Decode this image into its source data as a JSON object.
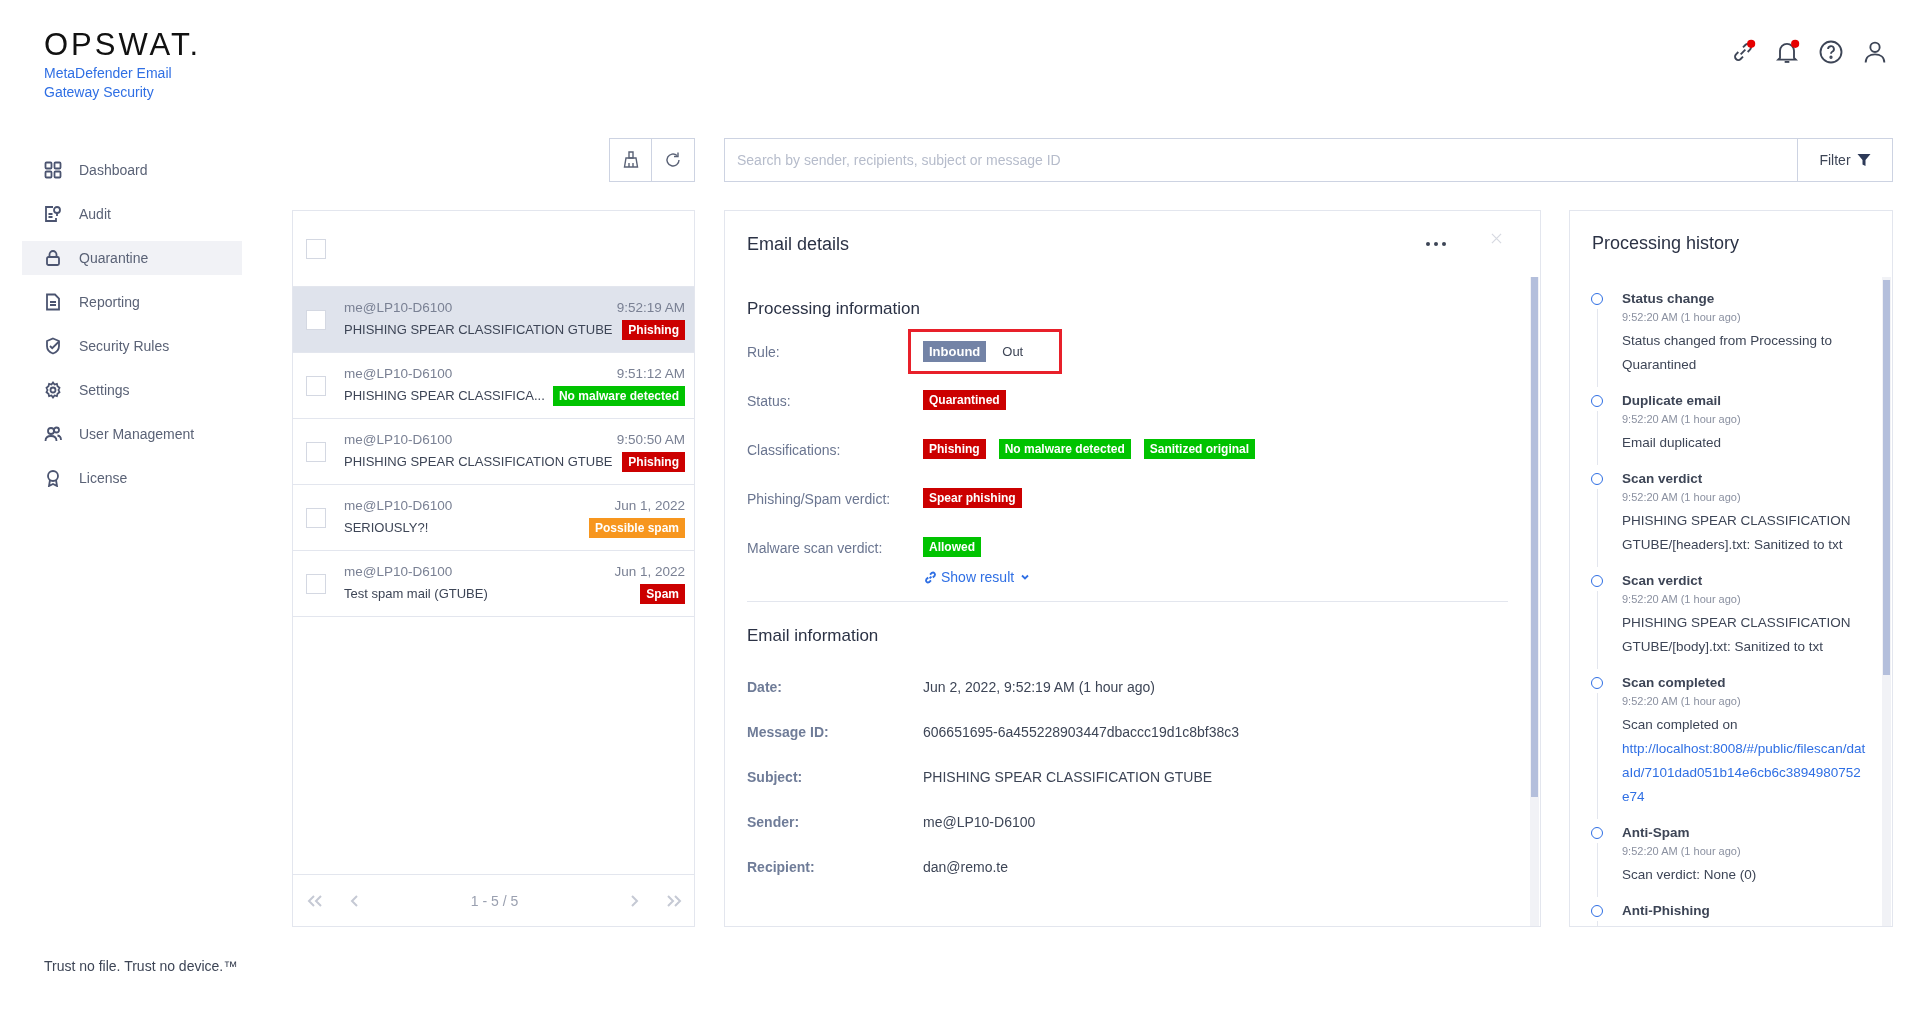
{
  "brand": {
    "logo": "OPSWAT.",
    "product": "MetaDefender Email Gateway Security"
  },
  "sidebar": {
    "items": [
      {
        "label": "Dashboard",
        "selected": false
      },
      {
        "label": "Audit",
        "selected": false
      },
      {
        "label": "Quarantine",
        "selected": true
      },
      {
        "label": "Reporting",
        "selected": false
      },
      {
        "label": "Security Rules",
        "selected": false
      },
      {
        "label": "Settings",
        "selected": false
      },
      {
        "label": "User Management",
        "selected": false
      },
      {
        "label": "License",
        "selected": false
      }
    ],
    "footer": "Trust no file. Trust no device.™"
  },
  "top_icons": [
    {
      "kind": "link",
      "alert": true
    },
    {
      "kind": "bell",
      "alert": true
    },
    {
      "kind": "help",
      "alert": false
    },
    {
      "kind": "user",
      "alert": false
    }
  ],
  "search": {
    "placeholder": "Search by sender, recipients, subject or message ID",
    "filter": "Filter"
  },
  "email_list": {
    "all_checked": false,
    "rows": [
      {
        "sender": "me@LP10-D6100",
        "time": "9:52:19 AM",
        "subject": "PHISHING SPEAR CLASSIFICATION GTUBE",
        "tag": "Phishing",
        "color": "#cc0000",
        "selected": true,
        "checked": false
      },
      {
        "sender": "me@LP10-D6100",
        "time": "9:51:12 AM",
        "subject": "PHISHING SPEAR CLASSIFICA...",
        "tag": "No malware detected",
        "color": "#00c300",
        "selected": false,
        "checked": false
      },
      {
        "sender": "me@LP10-D6100",
        "time": "9:50:50 AM",
        "subject": "PHISHING SPEAR CLASSIFICATION GTUBE",
        "tag": "Phishing",
        "color": "#cc0000",
        "selected": false,
        "checked": false
      },
      {
        "sender": "me@LP10-D6100",
        "time": "Jun 1, 2022",
        "subject": "SERIOUSLY?!",
        "tag": "Possible spam",
        "color": "#f7961e",
        "selected": false,
        "checked": false
      },
      {
        "sender": "me@LP10-D6100",
        "time": "Jun 1, 2022",
        "subject": "Test spam mail (GTUBE)",
        "tag": "Spam",
        "color": "#cc0000",
        "selected": false,
        "checked": false
      }
    ],
    "pagination": "1 - 5 / 5"
  },
  "email_details": {
    "title": "Email details",
    "processing": {
      "heading": "Processing information",
      "rule": {
        "label": "Rule:",
        "highlighted": true,
        "options": [
          {
            "label": "Inbound",
            "selected": true
          },
          {
            "label": "Out",
            "selected": false
          }
        ]
      },
      "fields": [
        {
          "label": "Status:",
          "tags": [
            {
              "text": "Quarantined",
              "color": "#cc0000"
            }
          ]
        },
        {
          "label": "Classifications:",
          "tags": [
            {
              "text": "Phishing",
              "color": "#cc0000"
            },
            {
              "text": "No malware detected",
              "color": "#00c300"
            },
            {
              "text": "Sanitized original",
              "color": "#00c300"
            }
          ]
        },
        {
          "label": "Phishing/Spam verdict:",
          "tags": [
            {
              "text": "Spear phishing",
              "color": "#cc0000"
            }
          ]
        },
        {
          "label": "Malware scan verdict:",
          "tags": [
            {
              "text": "Allowed",
              "color": "#00c300"
            }
          ],
          "link": "Show result"
        }
      ]
    },
    "information": {
      "heading": "Email information",
      "fields": [
        {
          "label": "Date:",
          "value": "Jun 2, 2022, 9:52:19 AM (1 hour ago)"
        },
        {
          "label": "Message ID:",
          "value": "606651695-6a455228903447dbaccc19d1c8bf38c3"
        },
        {
          "label": "Subject:",
          "value": "PHISHING SPEAR CLASSIFICATION GTUBE"
        },
        {
          "label": "Sender:",
          "value": "me@LP10-D6100"
        },
        {
          "label": "Recipient:",
          "value": "dan@remo.te"
        }
      ]
    }
  },
  "processing_history": {
    "title": "Processing history",
    "events": [
      {
        "title": "Status change",
        "time": "9:52:20 AM (1 hour ago)",
        "text": "Status changed from Processing to Quarantined"
      },
      {
        "title": "Duplicate email",
        "time": "9:52:20 AM (1 hour ago)",
        "text": "Email duplicated"
      },
      {
        "title": "Scan verdict",
        "time": "9:52:20 AM (1 hour ago)",
        "text": "PHISHING SPEAR CLASSIFICATION GTUBE/[headers].txt: Sanitized to txt"
      },
      {
        "title": "Scan verdict",
        "time": "9:52:20 AM (1 hour ago)",
        "text": "PHISHING SPEAR CLASSIFICATION GTUBE/[body].txt: Sanitized to txt"
      },
      {
        "title": "Scan completed",
        "time": "9:52:20 AM (1 hour ago)",
        "text": "Scan completed on",
        "link": "http://localhost:8008/#/public/filescan/dataId/7101dad051b14e6cb6c3894980752e74"
      },
      {
        "title": "Anti-Spam",
        "time": "9:52:20 AM (1 hour ago)",
        "text": "Scan verdict: None (0)"
      },
      {
        "title": "Anti-Phishing"
      }
    ]
  }
}
